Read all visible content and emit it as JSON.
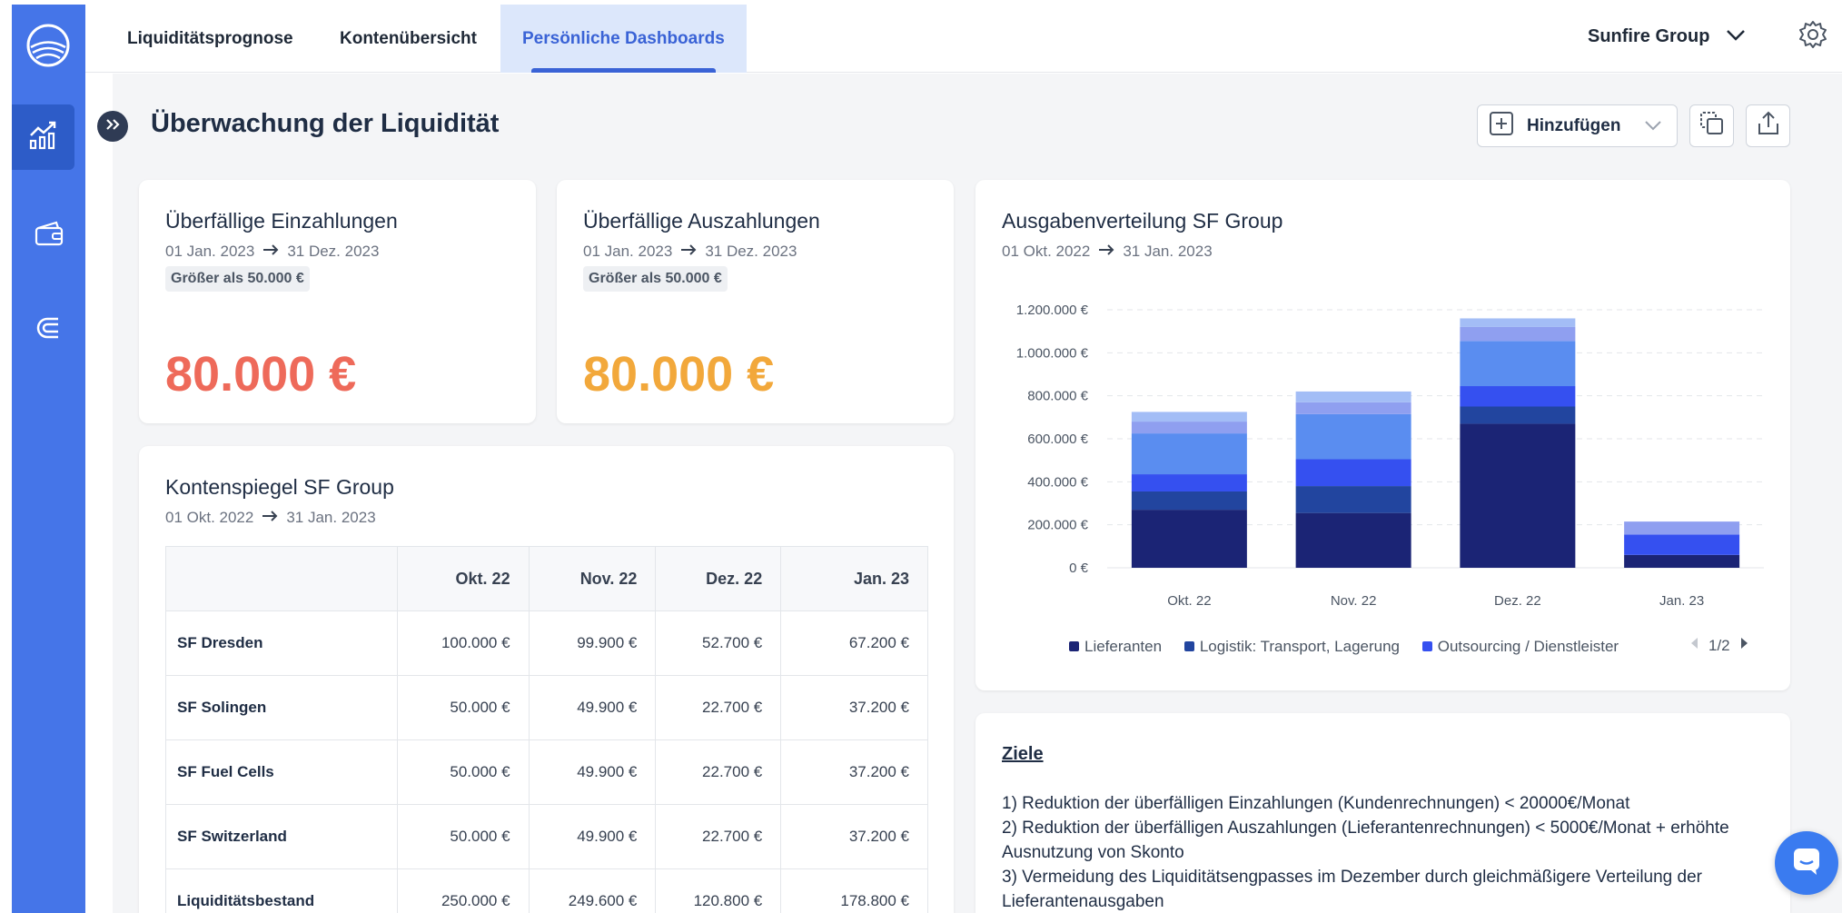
{
  "nav": {
    "tabs": [
      {
        "label": "Liquiditätsprognose"
      },
      {
        "label": "Kontenübersicht"
      },
      {
        "label": "Persönliche Dashboards"
      }
    ],
    "org_name": "Sunfire Group"
  },
  "sidebar": {
    "items": [
      {
        "icon": "chart-icon"
      },
      {
        "icon": "wallet-icon"
      },
      {
        "icon": "magnet-icon"
      }
    ]
  },
  "page": {
    "title": "Überwachung der Liquidität",
    "add_label": "Hinzufügen"
  },
  "cards": {
    "einzahlungen": {
      "title": "Überfällige Einzahlungen",
      "range_start": "01 Jan. 2023",
      "range_end": "31 Dez. 2023",
      "chip": "Größer als 50.000 €",
      "amount": "80.000 €"
    },
    "auszahlungen": {
      "title": "Überfällige Auszahlungen",
      "range_start": "01 Jan. 2023",
      "range_end": "31 Dez. 2023",
      "chip": "Größer als 50.000 €",
      "amount": "80.000 €"
    },
    "kontenspiegel": {
      "title": "Kontenspiegel SF Group",
      "range_start": "01 Okt. 2022",
      "range_end": "31 Jan. 2023",
      "columns": [
        "Okt. 22",
        "Nov. 22",
        "Dez. 22",
        "Jan. 23"
      ],
      "rows": [
        {
          "label": "SF Dresden",
          "values": [
            "100.000 €",
            "99.900 €",
            "52.700 €",
            "67.200 €"
          ]
        },
        {
          "label": "SF Solingen",
          "values": [
            "50.000 €",
            "49.900 €",
            "22.700 €",
            "37.200 €"
          ]
        },
        {
          "label": "SF Fuel Cells",
          "values": [
            "50.000 €",
            "49.900 €",
            "22.700 €",
            "37.200 €"
          ]
        },
        {
          "label": "SF Switzerland",
          "values": [
            "50.000 €",
            "49.900 €",
            "22.700 €",
            "37.200 €"
          ]
        },
        {
          "label": "Liquiditätsbestand",
          "values": [
            "250.000 €",
            "249.600 €",
            "120.800 €",
            "178.800 €"
          ]
        }
      ]
    },
    "ausgaben": {
      "title": "Ausgabenverteilung SF Group",
      "range_start": "01 Okt. 2022",
      "range_end": "31 Jan. 2023",
      "legend_page": "1/2"
    },
    "ziele": {
      "title": "Ziele",
      "lines": [
        "1) Reduktion der überfälligen Einzahlungen (Kundenrechnungen) < 20000€/Monat",
        "2) Reduktion der überfälligen Auszahlungen (Lieferantenrechnungen) < 5000€/Monat + erhöhte Ausnutzung von Skonto",
        "3) Vermeidung des Liquiditätsengpasses im Dezember durch gleichmäßigere Verteilung der Lieferantenausgaben"
      ]
    }
  },
  "colors": {
    "sidebar": "#4575e8",
    "accent": "#3a63d6",
    "red_amount": "#ee6a5a",
    "orange_amount": "#f2a83b"
  },
  "chart_data": {
    "type": "bar",
    "stacked": true,
    "categories": [
      "Okt. 22",
      "Nov. 22",
      "Dez. 22",
      "Jan. 23"
    ],
    "yticks": [
      "0 €",
      "200.000 €",
      "400.000 €",
      "600.000 €",
      "800.000 €",
      "1.000.000 €",
      "1.200.000 €"
    ],
    "ylim": [
      0,
      1200000
    ],
    "grid": true,
    "legend_position": "bottom",
    "series": [
      {
        "name": "Lieferanten",
        "color": "#1b2475",
        "values": [
          270000,
          255000,
          670000,
          60000
        ]
      },
      {
        "name": "Logistik: Transport, Lagerung",
        "color": "#22459f",
        "values": [
          85000,
          125000,
          80000,
          0
        ]
      },
      {
        "name": "Outsourcing / Dienstleister",
        "color": "#3550f0",
        "values": [
          80000,
          125000,
          95000,
          95000
        ]
      },
      {
        "name": "",
        "color": "#5a8df0",
        "values": [
          190000,
          210000,
          210000,
          0
        ]
      },
      {
        "name": "",
        "color": "#8f9ff0",
        "values": [
          55000,
          55000,
          65000,
          60000
        ]
      },
      {
        "name": "",
        "color": "#a3bdf6",
        "values": [
          45000,
          50000,
          40000,
          0
        ]
      }
    ]
  }
}
